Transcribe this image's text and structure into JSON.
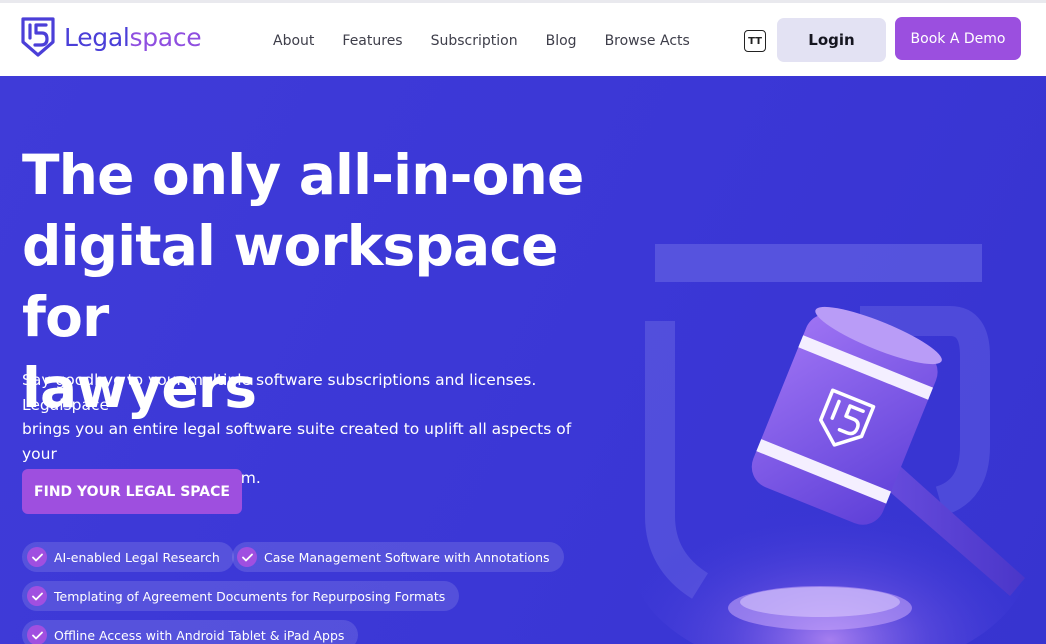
{
  "brand": {
    "name_part1": "Legal",
    "name_part2": "space",
    "primary_color": "#4b3fd8",
    "accent_color": "#9b4fdf",
    "hero_bg": "#3c3ad9"
  },
  "nav": {
    "links": [
      "About",
      "Features",
      "Subscription",
      "Blog",
      "Browse Acts"
    ],
    "font_toggle_icon": "text-size-icon",
    "font_toggle_glyph": "TT",
    "login_label": "Login",
    "demo_label": "Book A Demo"
  },
  "hero": {
    "headline_lines": [
      "The only all-in-one",
      "digital workspace for",
      "lawyers"
    ],
    "subtext_lines": [
      "Say goodbye to your multiple software subscriptions and licenses. Legalspace",
      "brings you an entire legal software suite created to uplift all aspects of your",
      "legal practice on one platform."
    ],
    "cta_label": "FIND YOUR LEGAL SPACE",
    "features": [
      "AI-enabled Legal Research",
      "Case Management Software with Annotations",
      "Templating of Agreement Documents for Repurposing Formats",
      "Offline Access with Android Tablet & iPad Apps"
    ],
    "illustration": "gavel-with-logo-icon"
  }
}
